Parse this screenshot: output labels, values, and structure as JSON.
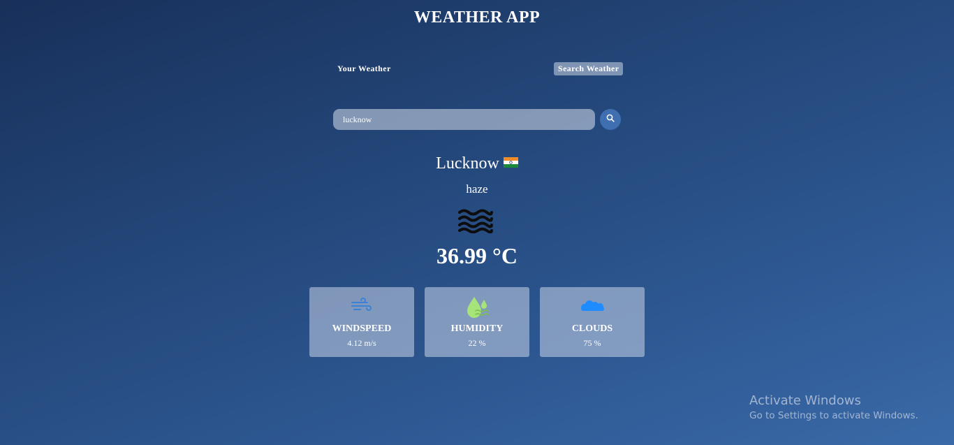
{
  "app": {
    "title": "WEATHER APP"
  },
  "tabs": {
    "your_weather": "Your Weather",
    "search_weather": "Search Weather"
  },
  "search": {
    "value": "lucknow",
    "icon": "search-icon"
  },
  "weather": {
    "city": "Lucknow",
    "country_flag": "india-flag",
    "condition": "haze",
    "condition_icon": "haze-icon",
    "temperature": "36.99 °C"
  },
  "cards": [
    {
      "title": "WINDSPEED",
      "value": "4.12 m/s",
      "icon": "wind-icon",
      "color": "#3b82d6"
    },
    {
      "title": "HUMIDITY",
      "value": "22 %",
      "icon": "humidity-icon",
      "color": "#a6e47a"
    },
    {
      "title": "CLOUDS",
      "value": "75 %",
      "icon": "clouds-icon",
      "color": "#1e8bff"
    }
  ],
  "watermark": {
    "title": "Activate Windows",
    "subtitle": "Go to Settings to activate Windows."
  },
  "colors": {
    "accent": "#3f6fb1"
  }
}
